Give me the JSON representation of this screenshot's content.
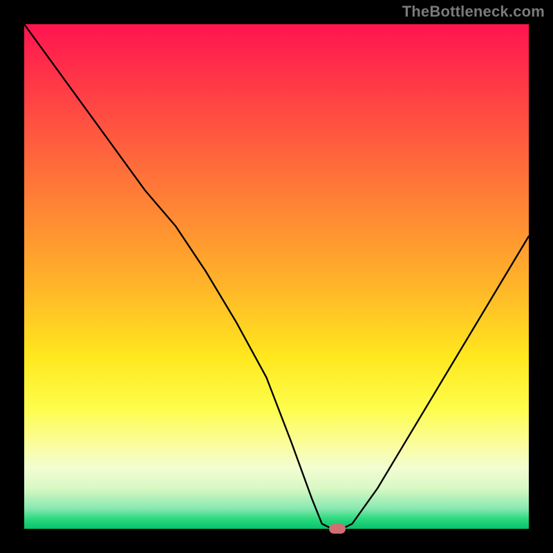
{
  "attribution": "TheBottleneck.com",
  "chart_data": {
    "type": "line",
    "title": "",
    "xlabel": "",
    "ylabel": "",
    "xlim": [
      0,
      100
    ],
    "ylim": [
      0,
      100
    ],
    "x": [
      0,
      8,
      16,
      24,
      30,
      36,
      42,
      48,
      53,
      57,
      59,
      61,
      63,
      65,
      70,
      76,
      82,
      88,
      94,
      100
    ],
    "values": [
      100,
      89,
      78,
      67,
      60,
      51,
      41,
      30,
      17,
      6,
      1,
      0,
      0,
      1,
      8,
      18,
      28,
      38,
      48,
      58
    ],
    "marker": {
      "x": 62,
      "y": 0
    },
    "gradient_stops": [
      {
        "pos": 0,
        "color": "#ff1450"
      },
      {
        "pos": 66,
        "color": "#ffe81e"
      },
      {
        "pos": 100,
        "color": "#07c26b"
      }
    ]
  }
}
